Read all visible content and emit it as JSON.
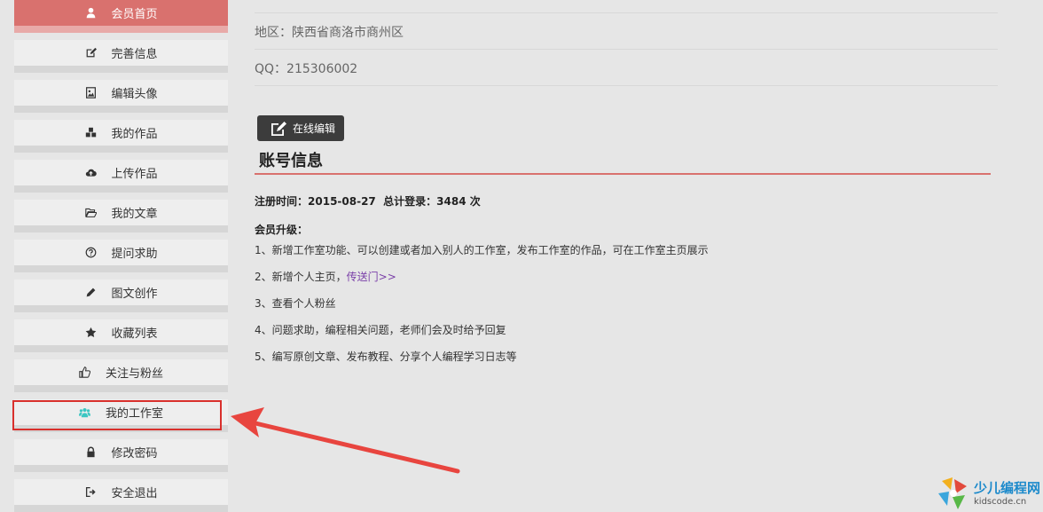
{
  "sidebar": {
    "items": [
      {
        "label": "会员首页",
        "icon": "user-icon",
        "active": true
      },
      {
        "label": "完善信息",
        "icon": "edit-icon"
      },
      {
        "label": "编辑头像",
        "icon": "image-icon"
      },
      {
        "label": "我的作品",
        "icon": "cubes-icon"
      },
      {
        "label": "上传作品",
        "icon": "cloud-upload-icon"
      },
      {
        "label": "我的文章",
        "icon": "folder-open-icon"
      },
      {
        "label": "提问求助",
        "icon": "question-circle-icon"
      },
      {
        "label": "图文创作",
        "icon": "pencil-icon"
      },
      {
        "label": "收藏列表",
        "icon": "star-icon"
      },
      {
        "label": "关注与粉丝",
        "icon": "thumbs-up-icon"
      },
      {
        "label": "我的工作室",
        "icon": "users-icon",
        "highlighted": true
      },
      {
        "label": "修改密码",
        "icon": "lock-icon"
      },
      {
        "label": "安全退出",
        "icon": "sign-out-icon"
      }
    ]
  },
  "profile": {
    "region": "地区：陕西省商洛市商州区",
    "qq": "QQ：215306002"
  },
  "edit_button": "在线编辑",
  "account": {
    "title": "账号信息",
    "reg_label": "注册时间：",
    "reg_date": "2015-08-27",
    "login_label": "总计登录：",
    "login_count": "3484 次",
    "upgrade_title": "会员升级：",
    "features": [
      "1、新增工作室功能、可以创建或者加入别人的工作室，发布工作室的作品，可在工作室主页展示",
      "2、新增个人主页，",
      "3、查看个人粉丝",
      "4、问题求助，编程相关问题，老师们会及时给予回复",
      "5、编写原创文章、发布教程、分享个人编程学习日志等"
    ],
    "portal_link": "传送门>>"
  },
  "logo": {
    "cn": "少儿编程网",
    "en": "kidscode.cn"
  },
  "colors": {
    "accent": "#d9716e",
    "highlight": "#d9302c",
    "team_icon": "#3cc6c2"
  }
}
